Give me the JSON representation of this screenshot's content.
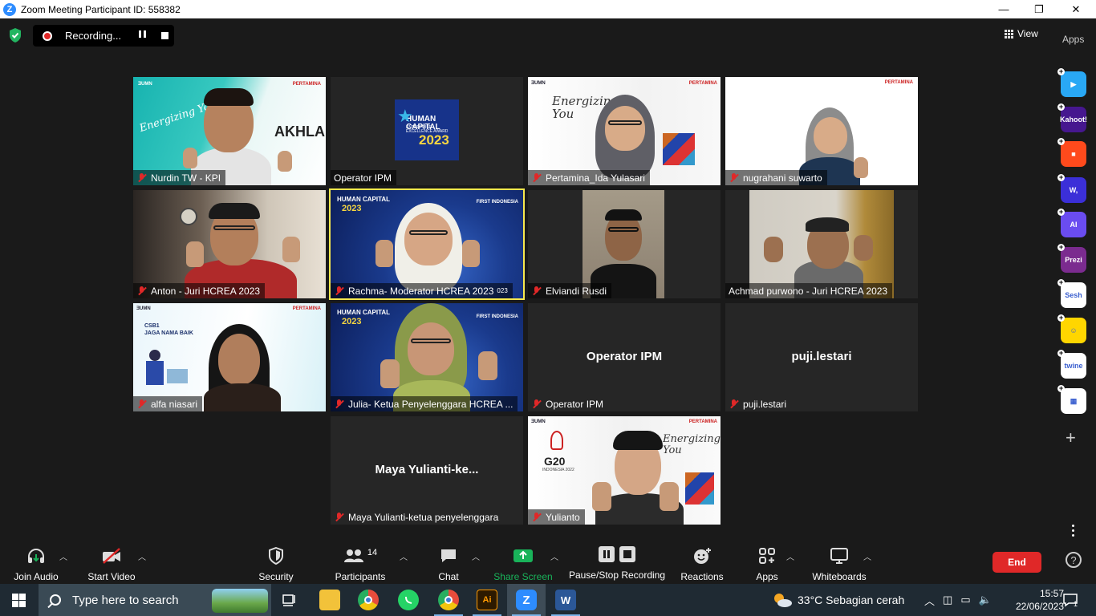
{
  "window": {
    "title": "Zoom Meeting Participant ID: 558382",
    "zoom_logo": "Z",
    "minimize": "—",
    "restore": "❐",
    "close": "✕"
  },
  "topbar": {
    "recording_label": "Recording...",
    "view_label": "View",
    "apps_label": "Apps"
  },
  "tiles": [
    {
      "name": "Nurdin TW - KPI",
      "brand": "PERTAMINA",
      "logo_text": "AKHLAK",
      "tagline": "Energizing You"
    },
    {
      "name": "Operator IPM",
      "logo_text": "HUMAN CAPITAL",
      "logo_sub": "ENTERPRISE EXCELLENCE AWARD",
      "logo_year": "2023"
    },
    {
      "name": "Pertamina_Ida Yulasari",
      "brand": "PERTAMINA",
      "tagline": "Energizing You"
    },
    {
      "name": "nugrahani suwarto",
      "brand": "PERTAMINA"
    },
    {
      "name": "Anton - Juri HCREA 2023"
    },
    {
      "name": "Rachma- Moderator HCREA 2023",
      "name_suffix": "023",
      "logo_text": "HUMAN CAPITAL",
      "logo_year": "2023",
      "corner": "FIRST INDONESIA"
    },
    {
      "name": "Elviandi Rusdi"
    },
    {
      "name": "Achmad purwono - Juri HCREA 2023"
    },
    {
      "name": "alfa niasari",
      "brand": "PERTAMINA",
      "banner_line1": "CSB1",
      "banner_line2": "JAGA NAMA BAIK"
    },
    {
      "name": "Julia- Ketua Penyelenggara HCREA ...",
      "logo_text": "HUMAN CAPITAL",
      "logo_year": "2023",
      "corner": "FIRST INDONESIA"
    },
    {
      "name": "Operator IPM",
      "center": "Operator IPM"
    },
    {
      "name": "puji.lestari",
      "center": "puji.lestari"
    },
    {
      "name": "Maya Yulianti-ketua penyelenggara",
      "center": "Maya  Yulianti-ke..."
    },
    {
      "name": "Yulianto",
      "brand": "PERTAMINA",
      "tagline": "Energizing You",
      "g20": "G20",
      "g20_sub": "INDONESIA 2022"
    }
  ],
  "apps_column": [
    {
      "name": "app-1",
      "color": "#29a8f5",
      "glyph": "▶"
    },
    {
      "name": "kahoot",
      "color": "#46178f",
      "glyph": "Kahoot!"
    },
    {
      "name": "app-3",
      "color": "#ff4a1c",
      "glyph": "■"
    },
    {
      "name": "app-w",
      "color": "#3b2fd8",
      "glyph": "W,"
    },
    {
      "name": "app-ai",
      "color": "#6a4cf0",
      "glyph": "AI"
    },
    {
      "name": "prezi",
      "color": "#7b2b8f",
      "glyph": "Prezi"
    },
    {
      "name": "sesh",
      "color": "#ffffff",
      "glyph": "Sesh"
    },
    {
      "name": "app-smile",
      "color": "#ffd600",
      "glyph": "☺"
    },
    {
      "name": "twine",
      "color": "#ffffff",
      "glyph": "twine"
    },
    {
      "name": "app-grid",
      "color": "#ffffff",
      "glyph": "▦"
    }
  ],
  "controls": {
    "join_audio": "Join Audio",
    "start_video": "Start Video",
    "security": "Security",
    "participants": "Participants",
    "participants_count": "14",
    "chat": "Chat",
    "share_screen": "Share Screen",
    "pause_stop_recording": "Pause/Stop Recording",
    "reactions": "Reactions",
    "apps": "Apps",
    "whiteboards": "Whiteboards",
    "end": "End",
    "help": "?"
  },
  "taskbar": {
    "search_placeholder": "Type here to search",
    "weather": "33°C  Sebagian cerah",
    "time": "15:57",
    "date": "22/06/2023",
    "notifications": "1"
  },
  "colors": {
    "accent_green": "#19b35a",
    "end_red": "#e02828",
    "active_outline": "#f7e84e",
    "mute_red": "#e02828"
  }
}
